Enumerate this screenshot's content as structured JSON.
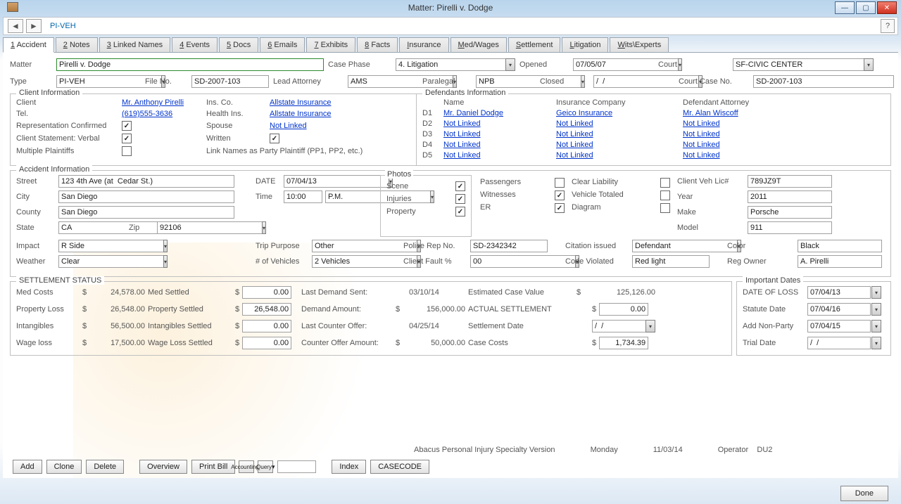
{
  "window": {
    "title": "Matter: Pirelli v. Dodge"
  },
  "toolbar": {
    "piveh": "PI-VEH"
  },
  "tabs": [
    {
      "mnemonic": "1",
      "label": "Accident",
      "active": true
    },
    {
      "mnemonic": "2",
      "label": "Notes"
    },
    {
      "mnemonic": "3",
      "label": "Linked Names"
    },
    {
      "mnemonic": "4",
      "label": "Events"
    },
    {
      "mnemonic": "5",
      "label": "Docs"
    },
    {
      "mnemonic": "6",
      "label": "Emails"
    },
    {
      "mnemonic": "7",
      "label": "Exhibits"
    },
    {
      "mnemonic": "8",
      "label": "Facts"
    },
    {
      "mnemonic": "I",
      "label": "nsurance",
      "full": "Insurance"
    },
    {
      "mnemonic": "M",
      "label": "ed/Wages",
      "full": "Med/Wages"
    },
    {
      "mnemonic": "S",
      "label": "ettlement",
      "full": "Settlement"
    },
    {
      "mnemonic": "L",
      "label": "itigation",
      "full": "Litigation"
    },
    {
      "mnemonic": "W",
      "label": "its\\Experts",
      "full": "Wits\\Experts"
    }
  ],
  "top": {
    "matter_lbl": "Matter",
    "matter": "Pirelli v. Dodge",
    "casephase_lbl": "Case Phase",
    "casephase": "4. Litigation",
    "opened_lbl": "Opened",
    "opened": "07/05/07",
    "court_lbl": "Court",
    "court": "SF-CIVIC CENTER",
    "type_lbl": "Type",
    "type": "PI-VEH",
    "fileno_lbl": "File No.",
    "fileno": "SD-2007-103",
    "leadatt_lbl": "Lead Attorney",
    "leadatt": "AMS",
    "paralegal_lbl": "Paralegal",
    "paralegal": "NPB",
    "closed_lbl": "Closed",
    "closed": "/  /",
    "ccn_lbl": "Court Case No.",
    "ccn": "SD-2007-103"
  },
  "client": {
    "legend": "Client Information",
    "client_lbl": "Client",
    "client": "Mr. Anthony Pirelli",
    "tel_lbl": "Tel.",
    "tel": "(619)555-3636",
    "rep_lbl": "Representation Confirmed",
    "rep": true,
    "stmt_lbl": "Client Statement: Verbal",
    "stmt": true,
    "multi_lbl": "Multiple Plaintiffs",
    "multi": false,
    "insco_lbl": "Ins. Co.",
    "insco": "Allstate Insurance",
    "health_lbl": "Health Ins.",
    "health": "Allstate Insurance",
    "spouse_lbl": "Spouse",
    "spouse": "Not Linked",
    "written_lbl": "Written",
    "written": true,
    "linknames_lbl": "Link Names as Party Plaintiff (PP1, PP2, etc.)"
  },
  "def": {
    "legend": "Defendants Information",
    "name_hdr": "Name",
    "ins_hdr": "Insurance Company",
    "att_hdr": "Defendant Attorney",
    "rows": [
      {
        "d": "D1",
        "name": "Mr. Daniel Dodge",
        "ins": "Geico Insurance",
        "att": "Mr. Alan Wiscoff"
      },
      {
        "d": "D2",
        "name": "Not Linked",
        "ins": "Not Linked",
        "att": "Not Linked"
      },
      {
        "d": "D3",
        "name": "Not Linked",
        "ins": "Not Linked",
        "att": "Not Linked"
      },
      {
        "d": "D4",
        "name": "Not Linked",
        "ins": "Not Linked",
        "att": "Not Linked"
      },
      {
        "d": "D5",
        "name": "Not Linked",
        "ins": "Not Linked",
        "att": "Not Linked"
      }
    ]
  },
  "acc": {
    "legend": "Accident Information",
    "street_lbl": "Street",
    "street": "123 4th Ave (at  Cedar St.)",
    "city_lbl": "City",
    "city": "San Diego",
    "county_lbl": "County",
    "county": "San Diego",
    "state_lbl": "State",
    "state": "CA",
    "zip_lbl": "Zip",
    "zip": "92106",
    "date_lbl": "DATE",
    "date": "07/04/13",
    "time_lbl": "Time",
    "time": "10:00",
    "ampm": "P.M.",
    "photos_legend": "Photos",
    "scene_lbl": "Scene",
    "scene": true,
    "injuries_lbl": "Injuries",
    "injuries": true,
    "property_lbl": "Property",
    "property": true,
    "passengers_lbl": "Passengers",
    "passengers": false,
    "witnesses_lbl": "Witnesses",
    "witnesses": true,
    "er_lbl": "ER",
    "er": true,
    "clearliab_lbl": "Clear Liability",
    "clearliab": false,
    "vehtot_lbl": "Vehicle Totaled",
    "vehtot": false,
    "diagram_lbl": "Diagram",
    "diagram": false,
    "vehlic_lbl": "Client Veh Lic#",
    "vehlic": "789JZ9T",
    "year_lbl": "Year",
    "year": "2011",
    "make_lbl": "Make",
    "make": "Porsche",
    "model_lbl": "Model",
    "model": "911",
    "color_lbl": "Color",
    "color_v": "Black",
    "regowner_lbl": "Reg Owner",
    "regowner": "A. Pirelli",
    "impact_lbl": "Impact",
    "impact": "R Side",
    "weather_lbl": "Weather",
    "weather": "Clear",
    "trip_lbl": "Trip Purpose",
    "trip": "Other",
    "numveh_lbl": "# of Vehicles",
    "numveh": "2 Vehicles",
    "police_lbl": "Police Rep No.",
    "police": "SD-2342342",
    "fault_lbl": "Client Fault %",
    "fault": "00",
    "citation_lbl": "Citation issued",
    "citation": "Defendant",
    "code_lbl": "Code Violated",
    "code": "Red light"
  },
  "set": {
    "legend": "SETTLEMENT STATUS",
    "medcosts_lbl": "Med Costs",
    "medcosts": "24,578.00",
    "proploss_lbl": "Property Loss",
    "proploss": "26,548.00",
    "intang_lbl": "Intangibles",
    "intang": "56,500.00",
    "wage_lbl": "Wage loss",
    "wage": "17,500.00",
    "medset_lbl": "Med Settled",
    "medset": "0.00",
    "propset_lbl": "Property Settled",
    "propset": "26,548.00",
    "intset_lbl": "Intangibles Settled",
    "intset": "0.00",
    "wageset_lbl": "Wage Loss Settled",
    "wageset": "0.00",
    "lastdem_lbl": "Last Demand Sent:",
    "lastdem": "03/10/14",
    "demamt_lbl": "Demand Amount:",
    "demamt": "156,000.00",
    "lastctr_lbl": "Last Counter Offer:",
    "lastctr": "04/25/14",
    "ctramt_lbl": "Counter Offer Amount:",
    "ctramt": "50,000.00",
    "ecv_lbl": "Estimated Case Value",
    "ecv": "125,126.00",
    "actual_lbl": "ACTUAL SETTLEMENT",
    "actual": "0.00",
    "setdate_lbl": "Settlement Date",
    "setdate": "/  /",
    "casecosts_lbl": "Case Costs",
    "casecosts": "1,734.39"
  },
  "idates": {
    "legend": "Important Dates",
    "dol_lbl": "DATE OF LOSS",
    "dol": "07/04/13",
    "stat_lbl": "Statute Date",
    "stat": "07/04/16",
    "addnp_lbl": "Add Non-Party",
    "addnp": "07/04/15",
    "trial_lbl": "Trial Date",
    "trial": "/  /"
  },
  "footer": {
    "brand": "Abacus Personal Injury Specialty Version",
    "day": "Monday",
    "date": "11/03/14",
    "op_lbl": "Operator",
    "op": "DU2",
    "add": "Add",
    "clone": "Clone",
    "delete": "Delete",
    "overview": "Overview",
    "print": "Print Bill",
    "accounting": "Accounting",
    "query": "Query",
    "index": "Index",
    "casecode": "CASECODE",
    "done": "Done"
  },
  "dollar": "$"
}
